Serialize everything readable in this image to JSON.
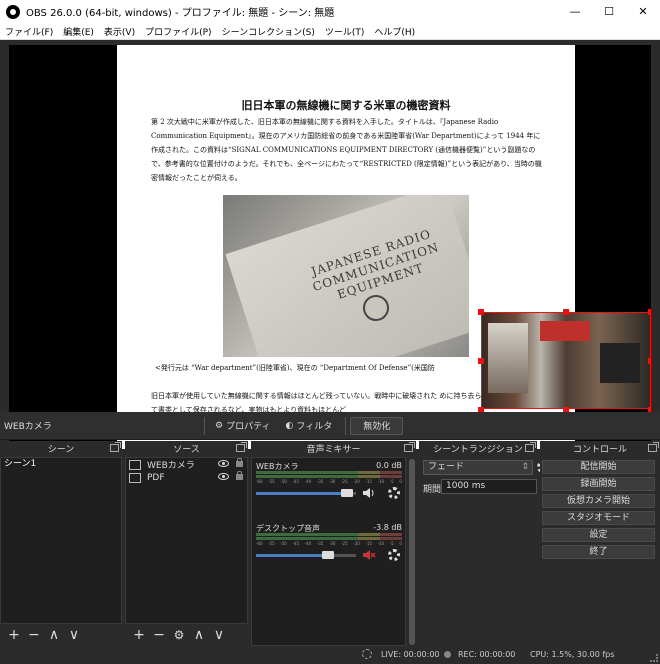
{
  "window": {
    "title": "OBS 26.0.0 (64-bit, windows) - プロファイル: 無題 - シーン: 無題",
    "controls": {
      "minimize": "—",
      "maximize": "☐",
      "close": "✕"
    }
  },
  "menu": [
    "ファイル(F)",
    "編集(E)",
    "表示(V)",
    "プロファイル(P)",
    "シーンコレクション(S)",
    "ツール(T)",
    "ヘルプ(H)"
  ],
  "preview": {
    "document": {
      "title": "旧日本軍の無線機に関する米軍の機密資料",
      "paragraph1": "第 2 次大戦中に米軍が作成した、旧日本軍の無線機に関する資料を入手した。タイトルは、『Japanese Radio Communication Equipment』。現在のアメリカ国防総省の前身である米国陸軍省(War Department)によって 1944 年に作成された。この資料は“SIGNAL COMMUNICATIONS EQUIPMENT DIRECTORY (通信機器便覧)”という副題なので、参考書的な位置付けのようだ。それでも、全ページにわたって“RESTRICTED (限定情報)”という表記があり、当時の機密情報だったことが伺える。",
      "photo_text": "JAPANESE RADIO COMMUNICATION EQUIPMENT",
      "caption": "<発行元は “War department”(旧陸軍省)、現在の “Department Of Defense”(米国防",
      "paragraph2": "旧日本軍が使用していた無線機に関する情報はほとんど残っていない。戦時中に破壊された めに持ち去られる、米軍によって書类として保存されるなど、実物はもとより資料もほとんど"
    }
  },
  "source_toolbar": {
    "current_source": "WEBカメラ",
    "properties": "プロパティ",
    "filters": "フィルタ",
    "deactivate": "無効化"
  },
  "scenes": {
    "title": "シーン",
    "items": [
      "シーン1"
    ]
  },
  "sources": {
    "title": "ソース",
    "items": [
      {
        "name": "WEBカメラ",
        "icon": "camera-icon"
      },
      {
        "name": "PDF",
        "icon": "window-icon"
      }
    ]
  },
  "mixer": {
    "title": "音声ミキサー",
    "scale": [
      "-60",
      "-55",
      "-50",
      "-45",
      "-40",
      "-35",
      "-30",
      "-25",
      "-20",
      "-15",
      "-10",
      "-5",
      "0"
    ],
    "channels": [
      {
        "name": "WEBカメラ",
        "db": "0.0 dB",
        "volume": 0.97,
        "muted": false
      },
      {
        "name": "デスクトップ音声",
        "db": "-3.8 dB",
        "volume": 0.78,
        "muted": true
      }
    ]
  },
  "transitions": {
    "title": "シーントランジション",
    "selected": "フェード",
    "duration_label": "期間",
    "duration_value": "1000 ms"
  },
  "controls": {
    "title": "コントロール",
    "buttons": [
      "配信開始",
      "録画開始",
      "仮想カメラ開始",
      "スタジオモード",
      "設定",
      "終了"
    ]
  },
  "status": {
    "live": "LIVE: 00:00:00",
    "rec": "REC: 00:00:00",
    "cpu": "CPU: 1.5%, 30.00 fps"
  },
  "colors": {
    "selection": "#e11111",
    "accent": "#4a7fc4",
    "muted": "#d23030"
  }
}
